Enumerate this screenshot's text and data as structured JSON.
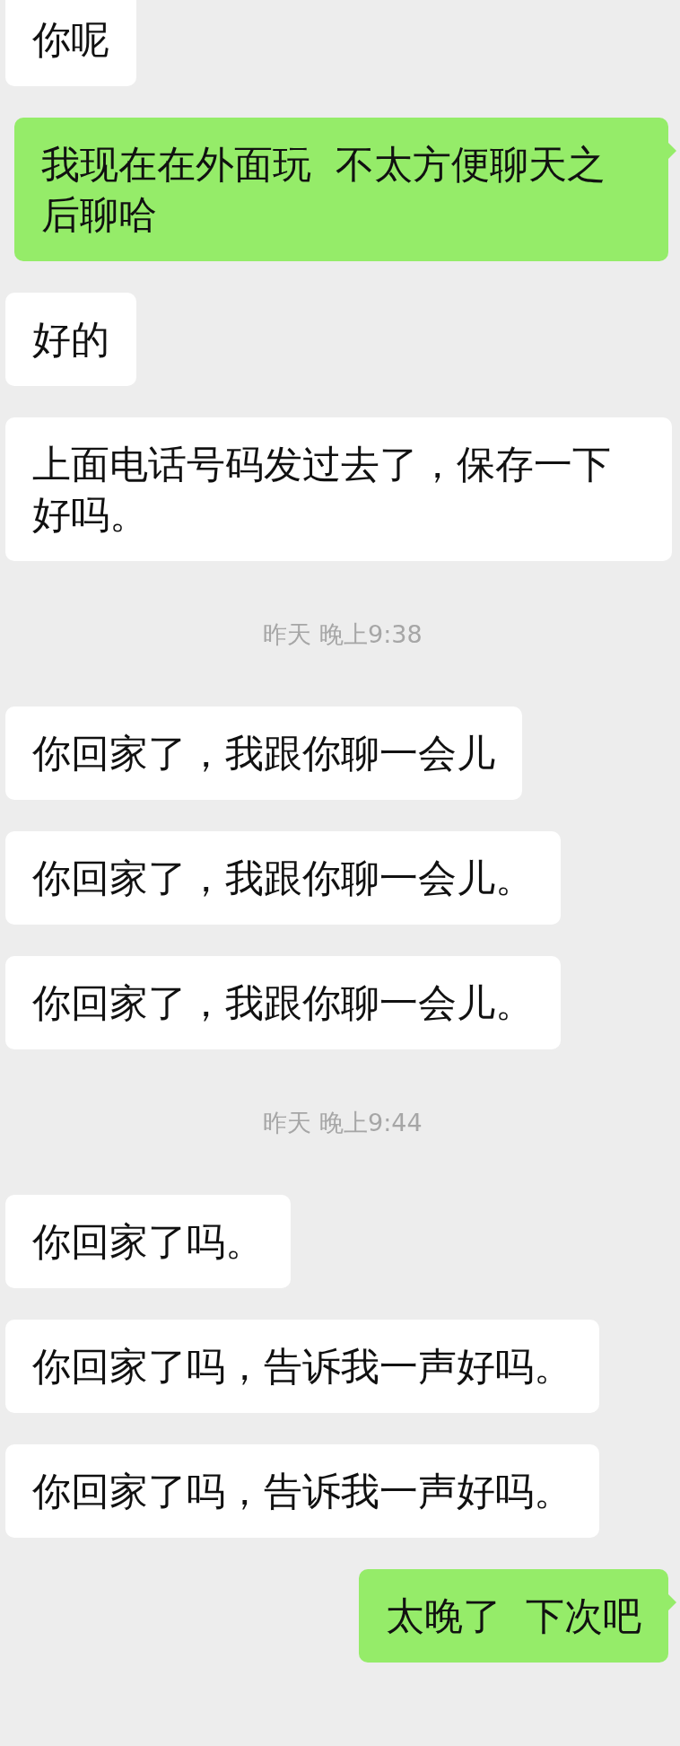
{
  "messages": [
    {
      "kind": "received",
      "text": "你呢"
    },
    {
      "kind": "sent",
      "text": "我现在在外面玩  不太方便聊天之后聊哈"
    },
    {
      "kind": "received",
      "text": "好的"
    },
    {
      "kind": "received",
      "text": "上面电话号码发过去了，保存一下好吗。"
    },
    {
      "kind": "time",
      "text": "昨天 晚上9:38"
    },
    {
      "kind": "received",
      "text": "你回家了，我跟你聊一会儿"
    },
    {
      "kind": "received",
      "text": "你回家了，我跟你聊一会儿。"
    },
    {
      "kind": "received",
      "text": "你回家了，我跟你聊一会儿。"
    },
    {
      "kind": "time",
      "text": "昨天 晚上9:44"
    },
    {
      "kind": "received",
      "text": "你回家了吗。"
    },
    {
      "kind": "received",
      "text": "你回家了吗，告诉我一声好吗。"
    },
    {
      "kind": "received",
      "text": "你回家了吗，告诉我一声好吗。"
    },
    {
      "kind": "sent",
      "text": "太晚了  下次吧"
    }
  ]
}
